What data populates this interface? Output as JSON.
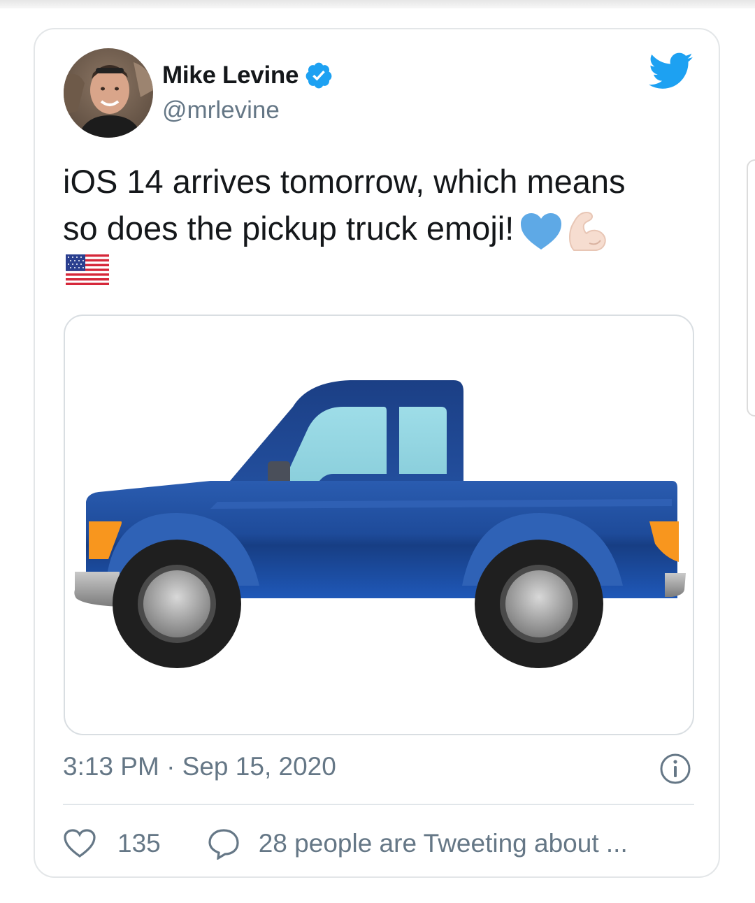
{
  "tweet": {
    "author": {
      "name": "Mike Levine",
      "handle": "@mrlevine",
      "verified": true
    },
    "text": {
      "line1": "iOS 14 arrives tomorrow, which means",
      "line2": "so does the pickup truck emoji!"
    },
    "emojis": [
      "blue-heart-emoji",
      "flexed-biceps-emoji",
      "us-flag-emoji"
    ],
    "media": {
      "subject": "pickup-truck-emoji"
    },
    "timestamp": "3:13 PM · Sep 15, 2020",
    "likes": "135",
    "tweeting_text": "28 people are Tweeting about ..."
  },
  "colors": {
    "twitter_blue": "#1da1f2",
    "text_primary": "#14171a",
    "text_secondary": "#657786",
    "truck_blue": "#1e4b9a",
    "window_blue": "#8fd3e0",
    "light_orange": "#f8961e"
  }
}
